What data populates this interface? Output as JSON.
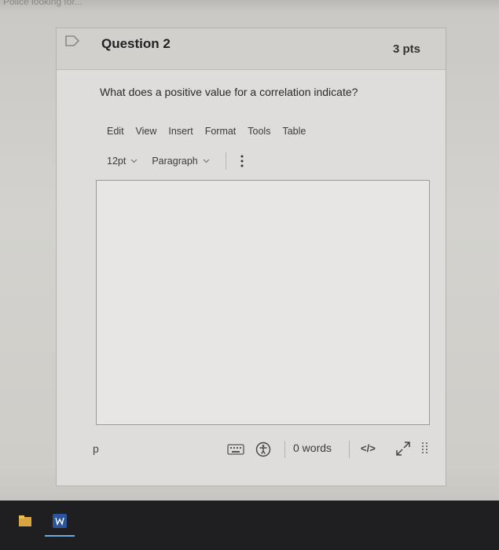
{
  "top_strip": {
    "text": "Police looking for..."
  },
  "question": {
    "title": "Question 2",
    "points": "3 pts",
    "prompt": "What does a positive value for a correlation indicate?"
  },
  "editor": {
    "menubar": [
      "Edit",
      "View",
      "Insert",
      "Format",
      "Tools",
      "Table"
    ],
    "toolbar": {
      "font_size": "12pt",
      "block_format": "Paragraph"
    },
    "content": "",
    "status": {
      "path": "p",
      "word_count": "0 words",
      "html_toggle": "</>"
    }
  },
  "icons": {
    "flag": "flag-icon",
    "keyboard": "keyboard-icon",
    "accessibility": "accessibility-icon",
    "fullscreen": "fullscreen-icon",
    "resize": "resize-handle-icon",
    "more": "more-vertical-icon"
  },
  "colors": {
    "card_bg": "#dedddb",
    "taskbar_bg": "#1f1f22",
    "word_blue": "#2b579a"
  }
}
